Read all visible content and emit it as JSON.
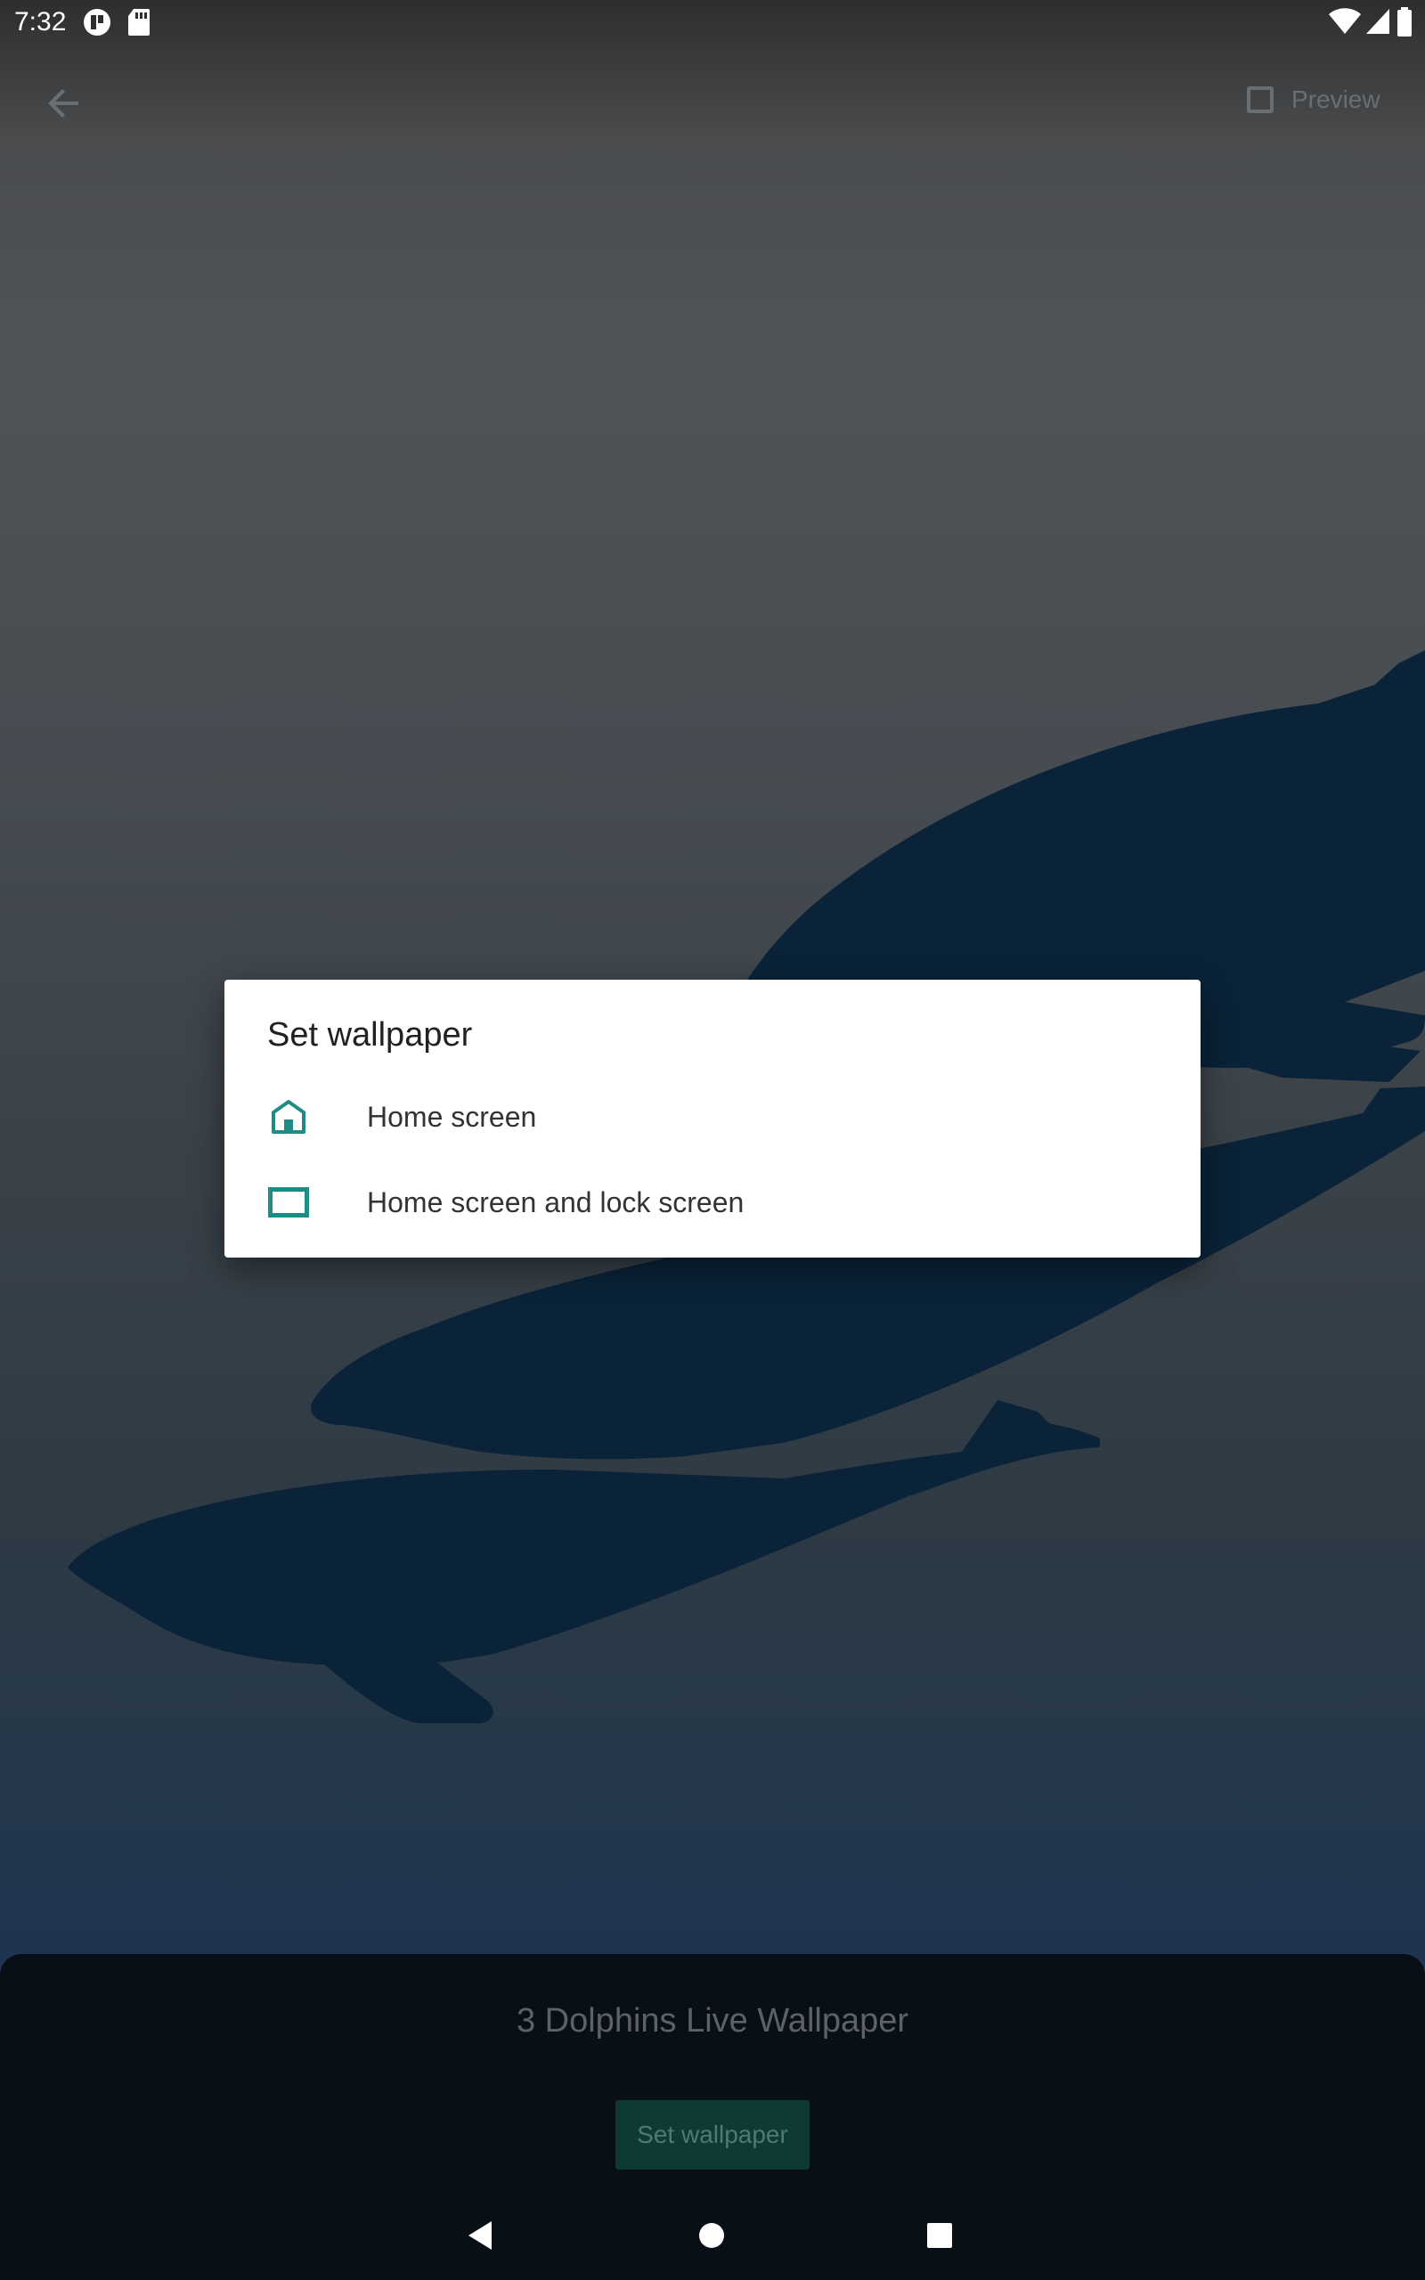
{
  "status_bar": {
    "time": "7:32",
    "left_icons": [
      "app-notification-icon",
      "sd-card-icon"
    ],
    "right_icons": [
      "wifi-icon",
      "cell-signal-icon",
      "battery-icon"
    ]
  },
  "top_bar": {
    "back_icon": "arrow-back-icon",
    "preview_label": "Preview",
    "preview_checked": false
  },
  "dialog": {
    "title": "Set wallpaper",
    "options": [
      {
        "label": "Home screen",
        "icon": "home-icon"
      },
      {
        "label": "Home screen and lock screen",
        "icon": "screen-icon"
      }
    ],
    "accent_color": "#1e8c84"
  },
  "bottom_sheet": {
    "wallpaper_name": "3 Dolphins Live Wallpaper",
    "set_button_label": "Set wallpaper"
  },
  "nav_bar": {
    "buttons": [
      "back-triangle-icon",
      "home-circle-icon",
      "recents-square-icon"
    ]
  },
  "colors": {
    "dolphin": "#0a2338",
    "sheet_background": "#080f17",
    "button_background": "#0d3a34"
  }
}
